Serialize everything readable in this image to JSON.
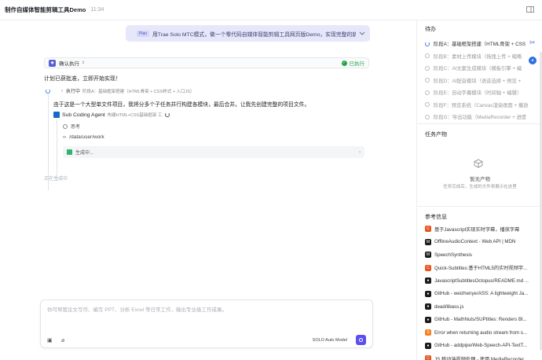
{
  "titlebar": {
    "title": "制作自媒体智能剪辑工具Demo",
    "time": "11:34"
  },
  "chat": {
    "user_message": {
      "tag": "Plan",
      "text": "用Trae Solo MTC模式，做一个零代码自媒体智能剪辑工具网页版Demo，实现完整的新手"
    },
    "confirm": {
      "label": "确认执行",
      "status": "已执行"
    },
    "plan_text": "计划已获批准，立即开始实现！",
    "exec": {
      "label": "执行中",
      "stage": "阶段A：基础框架搭建（HTML骨架 + CSS样式 + 入口JS）"
    },
    "detail_text": "由于这是一个大型单文件项目，我将分多个子任务并行构建各模块，最后合并。让我先创建完整的项目文件。",
    "agent": {
      "name": "Sub Coding Agent",
      "desc": "构建HTML+CSS基础框架 工"
    },
    "think_label": "思考",
    "path": "/data/user/work",
    "generating_box": "生成中...",
    "generating_status": "正在生成中"
  },
  "composer": {
    "placeholder": "你可帮我论文写作、编写 PPT、分析 Excel 等日常工作，输出专业级工作成果。",
    "model": "SOLO Auto Model"
  },
  "side": {
    "todo_title": "待办",
    "todos": [
      {
        "text": "阶段A：基础框架搭建（HTML骨架 + CSS",
        "active": true
      },
      {
        "text": "阶段B：素材上传模块（拖拽上传 + 缩略",
        "active": false
      },
      {
        "text": "阶段C：AI文案生成模块（模板引擎 + 编",
        "active": false
      },
      {
        "text": "阶段D：AI配音模块（语音选择 + 预览 +",
        "active": false
      },
      {
        "text": "阶段E：自动字幕模块（时间轴 + 编辑）",
        "active": false
      },
      {
        "text": "阶段F：预览系统（Canvas渲染画面 + 播放",
        "active": false
      },
      {
        "text": "阶段G：导出功能（MediaRecorder + 进度",
        "active": false
      }
    ],
    "output_title": "任务产物",
    "empty_title": "暂无产物",
    "empty_sub": "任务完成后，生成的文件将展示在这里",
    "ref_title": "参考信息",
    "refs": [
      {
        "text": "基于Javascript实现实时字幕，播放字幕",
        "icon": "csdn-icon",
        "color": "#e8531e"
      },
      {
        "text": "OfflineAudioContext - Web API | MDN",
        "icon": "mdn-icon",
        "color": "#1b1b1b"
      },
      {
        "text": "SpeechSynthesis",
        "icon": "mdn-icon",
        "color": "#1b1b1b"
      },
      {
        "text": "Quick-Subtitles:基于HTML5的实时视频字...",
        "icon": "csdn-icon",
        "color": "#e8531e"
      },
      {
        "text": "JavascriptSubtitlesOctopus/README.md ...",
        "icon": "github-icon",
        "color": "#1b1b1b"
      },
      {
        "text": "GitHub - weizhenye/ASS: A lightweight Ja...",
        "icon": "github-icon",
        "color": "#1b1b1b"
      },
      {
        "text": "dead/libass.js",
        "icon": "github-icon",
        "color": "#1b1b1b"
      },
      {
        "text": "GitHub - MathNuts/SUPtitles: Renders Bl...",
        "icon": "github-icon",
        "color": "#1b1b1b"
      },
      {
        "text": "Error when returning audio stream from s...",
        "icon": "stackoverflow-icon",
        "color": "#f48024"
      },
      {
        "text": "GitHub - addpipe/Web-Speech-API-TextT...",
        "icon": "github-icon",
        "color": "#1b1b1b"
      },
      {
        "text": "JS 移动端视频处理 - 使用 MediaRecorder...",
        "icon": "csdn-icon",
        "color": "#e8531e"
      }
    ]
  }
}
